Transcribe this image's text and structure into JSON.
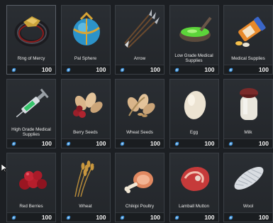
{
  "items": [
    {
      "name": "Ring of Mercy",
      "qty": "100",
      "icon": "ring-icon"
    },
    {
      "name": "Pal Sphere",
      "qty": "100",
      "icon": "pal-sphere-icon"
    },
    {
      "name": "Arrow",
      "qty": "100",
      "icon": "arrow-icon"
    },
    {
      "name": "Low Grade Medical Supplies",
      "qty": "100",
      "icon": "medical-bowl-icon"
    },
    {
      "name": "Medical Supplies",
      "qty": "100",
      "icon": "pill-bottle-icon"
    },
    {
      "name": "High Grade Medical Supplies",
      "qty": "100",
      "icon": "syringe-icon"
    },
    {
      "name": "Berry Seeds",
      "qty": "100",
      "icon": "berry-seeds-icon"
    },
    {
      "name": "Wheat Seeds",
      "qty": "100",
      "icon": "wheat-seeds-icon"
    },
    {
      "name": "Egg",
      "qty": "100",
      "icon": "egg-icon"
    },
    {
      "name": "Milk",
      "qty": "100",
      "icon": "milk-jar-icon"
    },
    {
      "name": "Red Berries",
      "qty": "100",
      "icon": "red-berries-icon"
    },
    {
      "name": "Wheat",
      "qty": "100",
      "icon": "wheat-icon"
    },
    {
      "name": "Chikipi Poultry",
      "qty": "100",
      "icon": "poultry-icon"
    },
    {
      "name": "Lamball Mutton",
      "qty": "100",
      "icon": "mutton-icon"
    },
    {
      "name": "Wool",
      "qty": "100",
      "icon": "wool-icon"
    }
  ],
  "colors": {
    "currency": "#3b8fd6",
    "slot_bg": "#2a2e33",
    "border": "#3a3f45"
  }
}
